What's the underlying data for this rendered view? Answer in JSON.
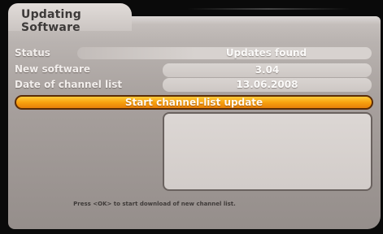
{
  "title": "Updating Software",
  "rows": {
    "status": {
      "label": "Status",
      "value": "Updates found"
    },
    "new_software": {
      "label": "New software",
      "value": "3.04"
    },
    "date_channel_list": {
      "label": "Date of channel list",
      "value": "13.06.2008"
    }
  },
  "action_button": {
    "label": "Start channel-list update"
  },
  "hint": "Press <OK> to start download of new channel list.",
  "colors": {
    "panel": "#a7a09d",
    "button": "#f8a10e",
    "button_border": "#5a2c07",
    "background": "#0a0a0a"
  }
}
